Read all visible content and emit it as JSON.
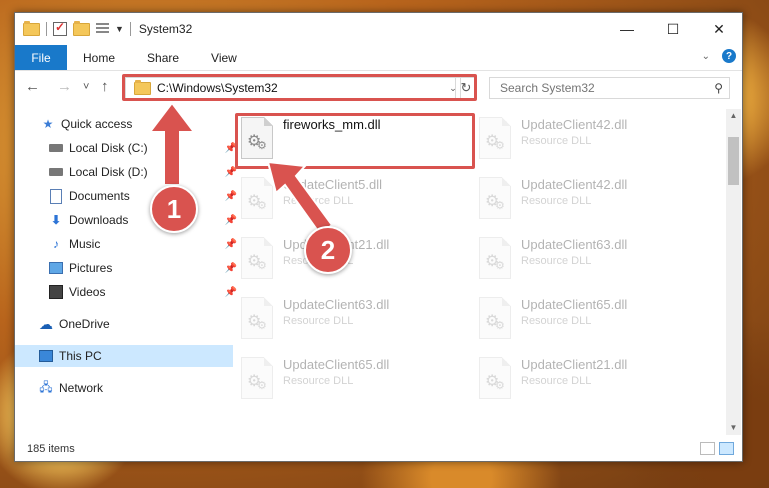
{
  "window": {
    "title": "System32"
  },
  "titlebar": {
    "minimize": "—",
    "maximize": "☐",
    "close": "✕"
  },
  "ribbon": {
    "tabs": [
      "File",
      "Home",
      "Share",
      "View"
    ]
  },
  "navigation": {
    "back": "←",
    "forward": "→",
    "recent": "˅",
    "up": "↑",
    "address": "C:\\Windows\\System32",
    "refresh": "↻",
    "search_placeholder": "Search System32"
  },
  "sidebar": {
    "items": [
      {
        "label": "Quick access",
        "icon": "star-icon",
        "pinned": false
      },
      {
        "label": "Local Disk (C:)",
        "icon": "drive-icon",
        "pinned": true
      },
      {
        "label": "Local Disk (D:)",
        "icon": "drive-icon",
        "pinned": true
      },
      {
        "label": "Documents",
        "icon": "documents-icon",
        "pinned": true
      },
      {
        "label": "Downloads",
        "icon": "downloads-icon",
        "pinned": true
      },
      {
        "label": "Music",
        "icon": "music-icon",
        "pinned": true
      },
      {
        "label": "Pictures",
        "icon": "pictures-icon",
        "pinned": true
      },
      {
        "label": "Videos",
        "icon": "videos-icon",
        "pinned": true
      },
      {
        "label": "OneDrive",
        "icon": "onedrive-icon",
        "pinned": false
      },
      {
        "label": "This PC",
        "icon": "this-pc-icon",
        "pinned": false,
        "selected": true
      },
      {
        "label": "Network",
        "icon": "network-icon",
        "pinned": false
      }
    ]
  },
  "files": [
    {
      "name": "fireworks_mm.dll",
      "type": "",
      "highlighted": true
    },
    {
      "name": "UpdateClient42.dll",
      "type": "Resource DLL"
    },
    {
      "name": "UpdateClient5.dll",
      "type": "Resource DLL"
    },
    {
      "name": "UpdateClient42.dll",
      "type": "Resource DLL"
    },
    {
      "name": "UpdateClient21.dll",
      "type": "Resource DLL"
    },
    {
      "name": "UpdateClient63.dll",
      "type": "Resource DLL"
    },
    {
      "name": "UpdateClient63.dll",
      "type": "Resource DLL"
    },
    {
      "name": "UpdateClient65.dll",
      "type": "Resource DLL"
    },
    {
      "name": "UpdateClient65.dll",
      "type": "Resource DLL"
    },
    {
      "name": "UpdateClient21.dll",
      "type": "Resource DLL"
    }
  ],
  "status": {
    "item_count": "185 items"
  },
  "annotations": {
    "step1": "1",
    "step2": "2",
    "color": "#d9534f"
  }
}
